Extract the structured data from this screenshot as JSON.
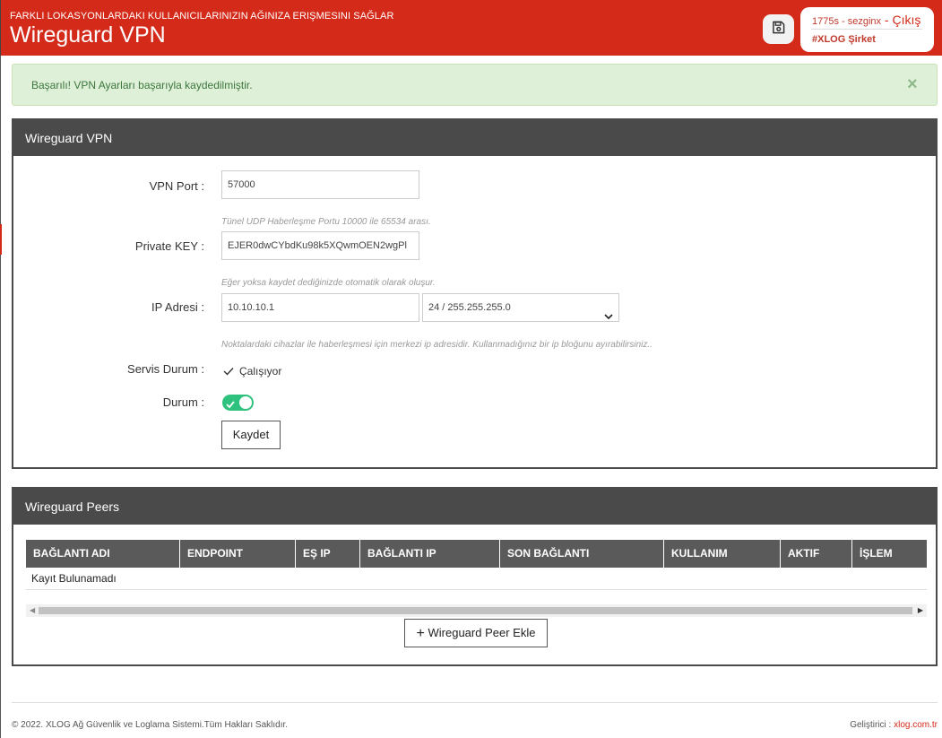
{
  "header": {
    "subtitle": "FARKLI LOKASYONLARDAKI KULLANICILARINIZIN AĞINIZA ERIŞMESINI SAĞLAR",
    "title": "Wireguard VPN",
    "save_icon": "floppy-disk-icon",
    "user": {
      "session": "1775s - sezginx",
      "logout_sep": " - ",
      "logout": "Çıkış",
      "company": "#XLOG Şirket"
    }
  },
  "alert": {
    "message": "Başarılı! VPN Ayarları başarıyla kaydedilmiştir.",
    "close": "×",
    "color": "#dff0d8"
  },
  "vpn_panel": {
    "title": "Wireguard VPN",
    "port_label": "VPN Port :",
    "port_value": "57000",
    "port_help": "Tünel UDP Haberleşme Portu 10000 ile 65534 arası.",
    "key_label": "Private KEY :",
    "key_value": "EJER0dwCYbdKu98k5XQwmOEN2wgPl",
    "key_help": "Eğer yoksa kaydet dediğinizde otomatik olarak oluşur.",
    "ip_label": "IP Adresi :",
    "ip_value": "10.10.10.1",
    "mask_value": "24 / 255.255.255.0",
    "ip_help": "Noktalardaki cihazlar ile haberleşmesi için merkezi ip adresidir. Kullanmadığınız bir ip bloğunu ayırabilirsiniz..",
    "service_label": "Servis Durum :",
    "service_value": "Çalışıyor",
    "status_label": "Durum :",
    "status_on": true,
    "save_button": "Kaydet"
  },
  "peers_panel": {
    "title": "Wireguard Peers",
    "columns": [
      "BAĞLANTI ADI",
      "ENDPOINT",
      "EŞ IP",
      "BAĞLANTI IP",
      "SON BAĞLANTI",
      "KULLANIM",
      "AKTIF",
      "İŞLEM"
    ],
    "empty_text": "Kayıt Bulunamadı",
    "add_button": "Wireguard Peer Ekle"
  },
  "footer": {
    "copyright": "© 2022. XLOG Ağ Güvenlik ve Loglama Sistemi.Tüm Hakları Saklıdır.",
    "dev_label": "Geliştirici : ",
    "dev_link": "xlog.com.tr"
  },
  "colors": {
    "brand": "#d42a1a",
    "panel_head": "#4a4a4a",
    "toggle_on": "#2ec27e"
  }
}
